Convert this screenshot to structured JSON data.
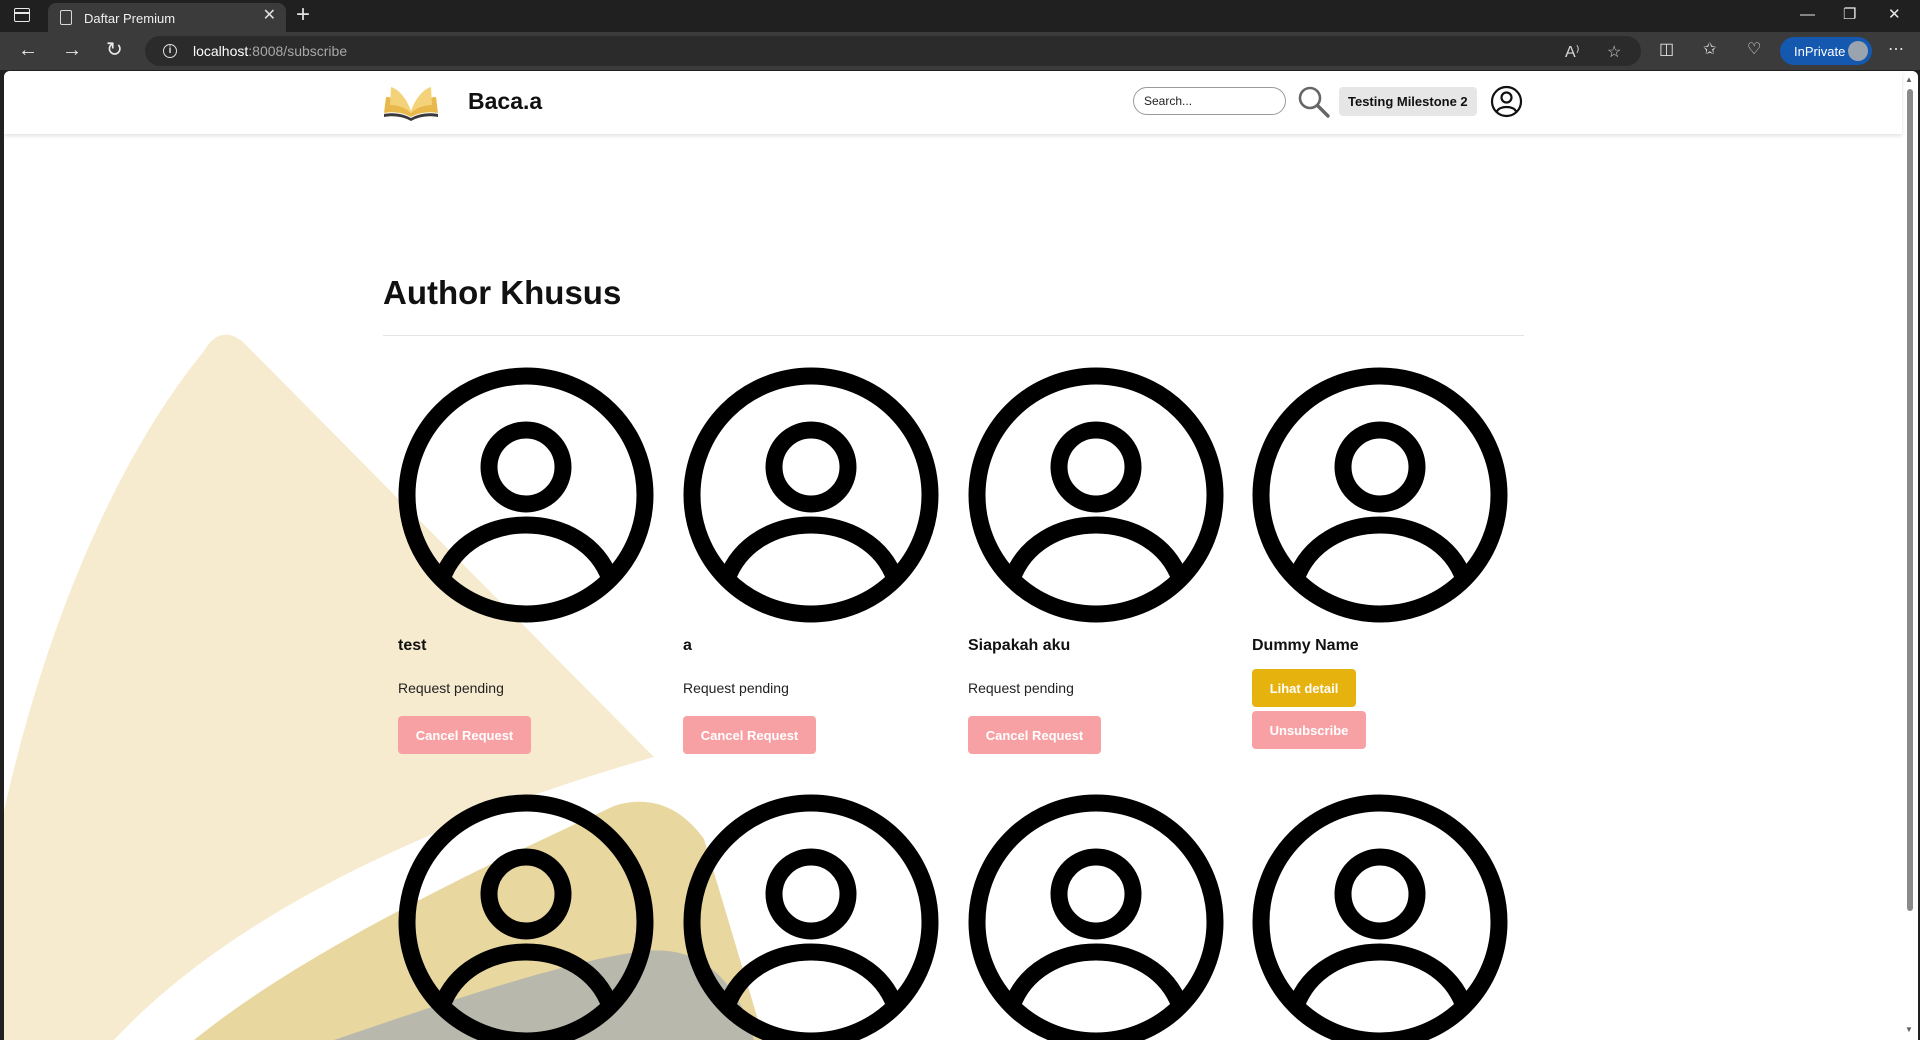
{
  "browser": {
    "tab_title": "Daftar Premium",
    "url_host": "localhost",
    "url_rest": ":8008/subscribe",
    "inprivate_label": "InPrivate"
  },
  "navbar": {
    "brand": "Baca.a",
    "search_placeholder": "Search...",
    "user_label": "Testing Milestone 2"
  },
  "main": {
    "title": "Author Khusus",
    "authors": [
      {
        "name": "test",
        "status": "Request pending",
        "action": "Cancel Request"
      },
      {
        "name": "a",
        "status": "Request pending",
        "action": "Cancel Request"
      },
      {
        "name": "Siapakah aku",
        "status": "Request pending",
        "action": "Cancel Request"
      },
      {
        "name": "Dummy Name",
        "detail": "Lihat detail",
        "action": "Unsubscribe"
      }
    ]
  },
  "colors": {
    "accent_yellow": "#e6b20e",
    "cancel_pink": "#f8a1a4",
    "bg_cream": "#f7ebcf",
    "bg_tan": "#e9d7a0",
    "bg_gray": "#b8b8ad"
  }
}
